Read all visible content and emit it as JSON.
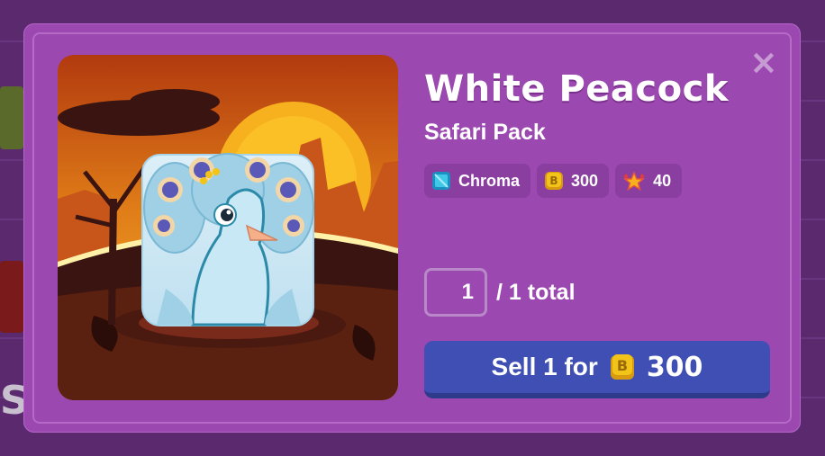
{
  "modal": {
    "title": "White Peacock",
    "subtitle": "Safari Pack",
    "close_icon": "close-icon",
    "badges": [
      {
        "icon": "chroma-gem-icon",
        "label": "Chroma"
      },
      {
        "icon": "token-coin-icon",
        "label": "300"
      },
      {
        "icon": "xp-star-icon",
        "label": "40"
      }
    ],
    "quantity": {
      "value": "1",
      "total_text": "/ 1 total"
    },
    "sell_button": {
      "label": "Sell 1 for",
      "coin_icon": "token-coin-icon",
      "price": "300"
    }
  },
  "background": {
    "partial_letter": "S"
  },
  "colors": {
    "modal_bg": "#9b48b0",
    "page_bg": "#5b2a6e",
    "sell_button": "#3f4fb3",
    "badge_bg": "#8a3ea0",
    "coin": "#f2c318"
  }
}
